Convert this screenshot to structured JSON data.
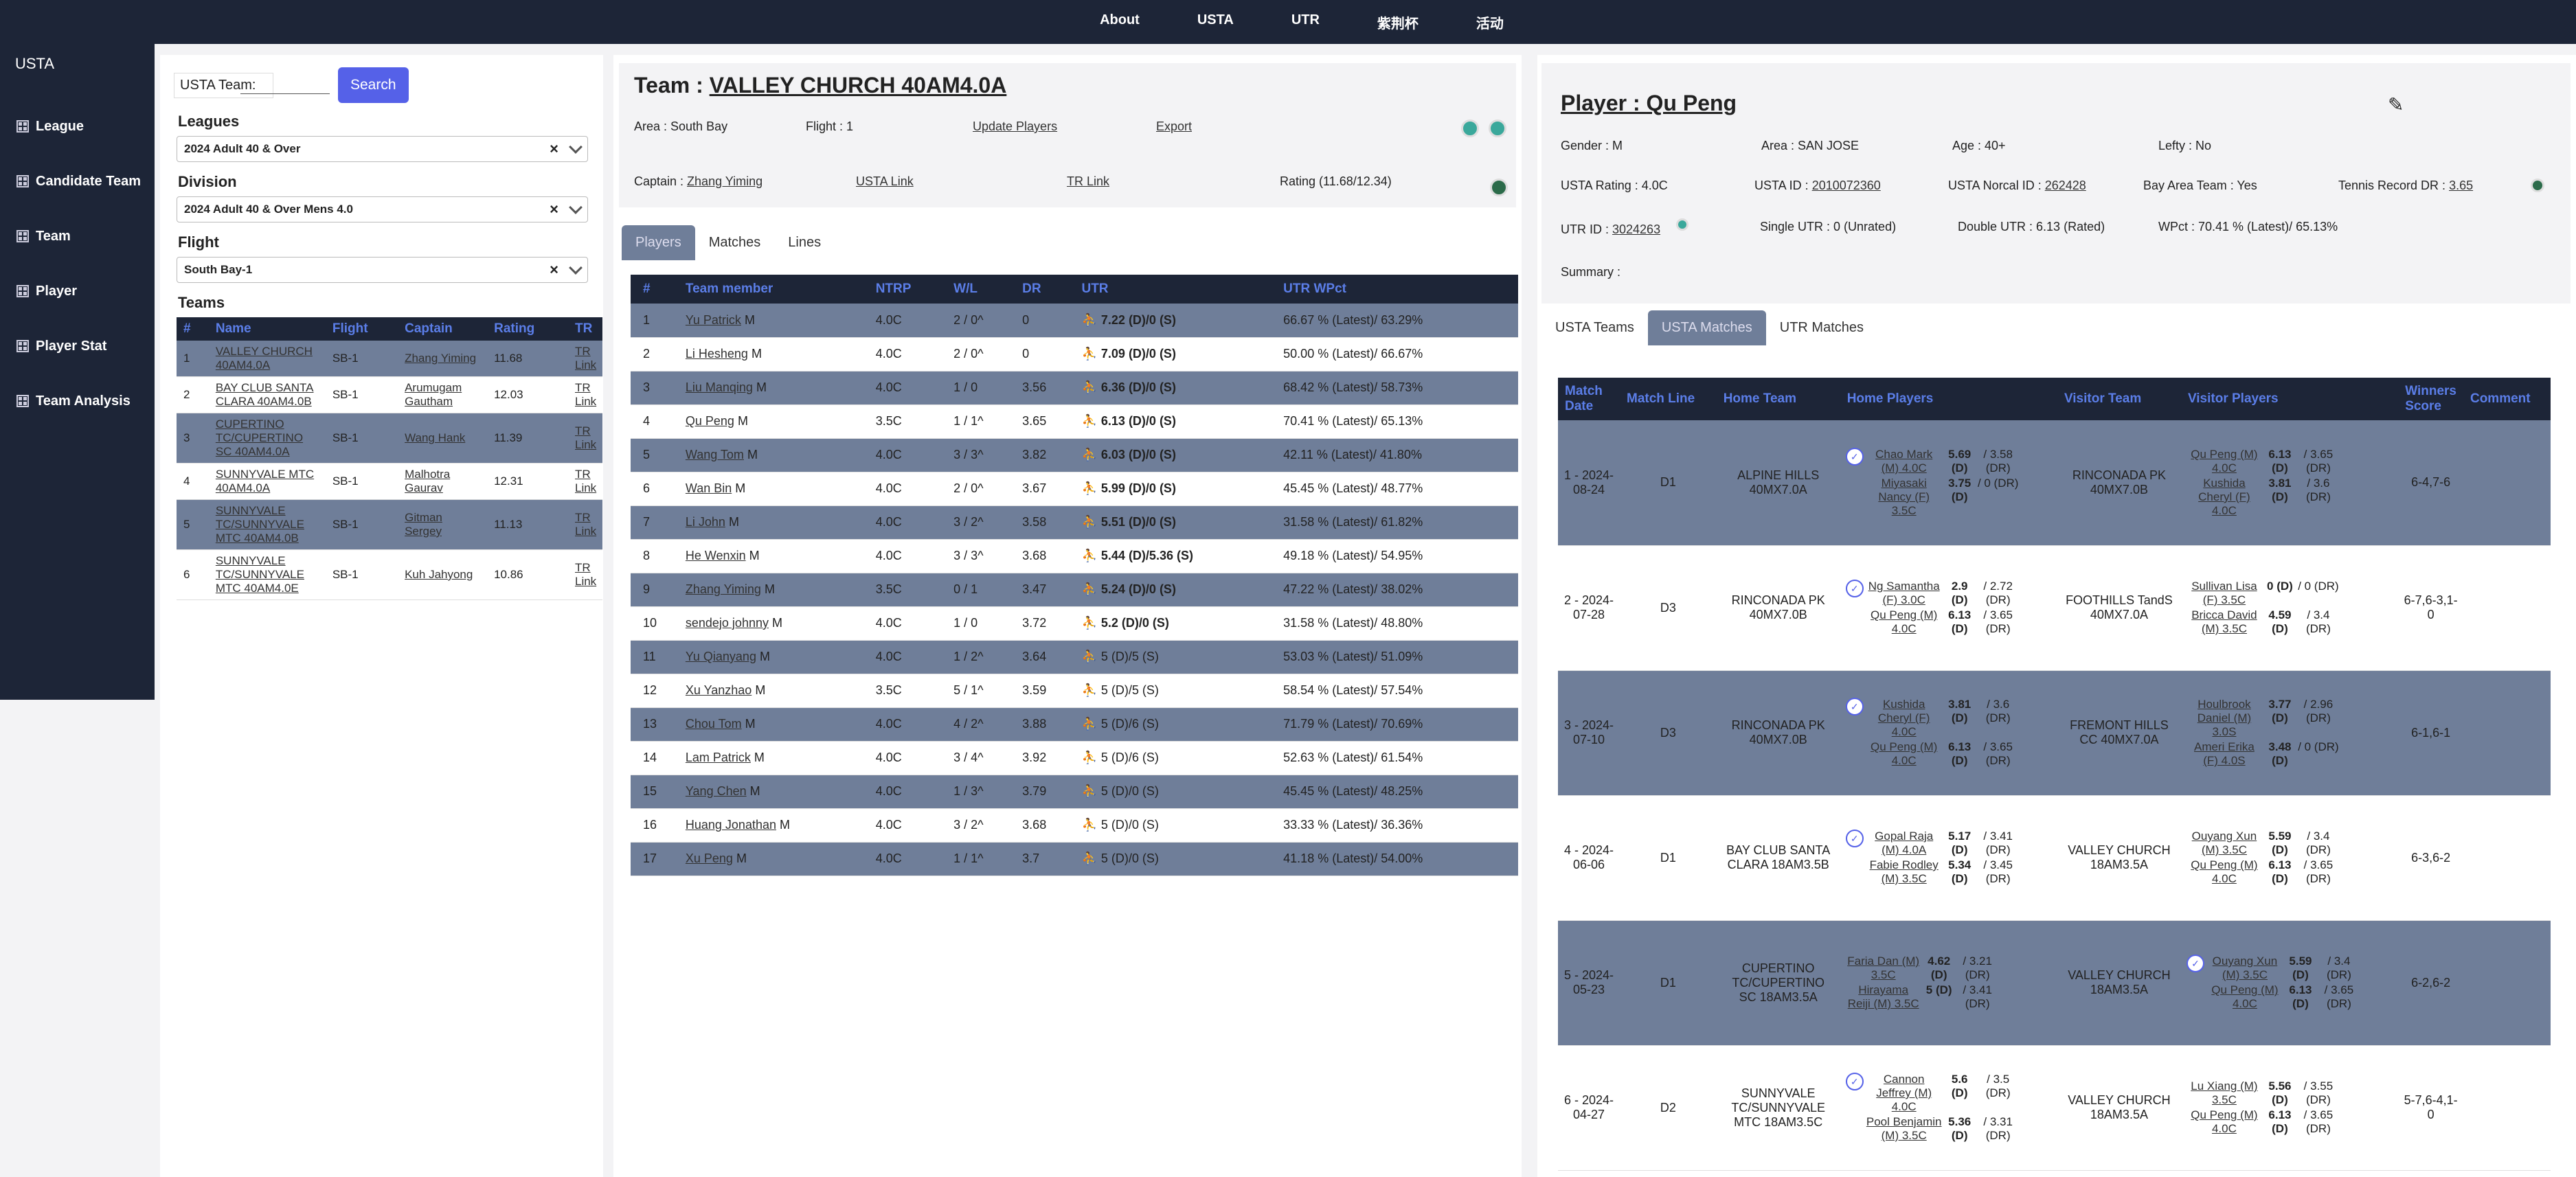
{
  "nav": {
    "items": [
      "About",
      "USTA",
      "UTR",
      "紫荆杯",
      "活动"
    ]
  },
  "sidebar": {
    "brand": "USTA",
    "items": [
      "League",
      "Candidate Team",
      "Team",
      "Player",
      "Player Stat",
      "Team Analysis"
    ]
  },
  "left": {
    "usta_team_label": "USTA Team:",
    "search": "Search",
    "leagues_label": "Leagues",
    "league_value": "2024 Adult 40 & Over",
    "division_label": "Division",
    "division_value": "2024 Adult 40 & Over Mens 4.0",
    "flight_label": "Flight",
    "flight_value": "South Bay-1",
    "teams_label": "Teams",
    "clear": "×",
    "cols": [
      "#",
      "Name",
      "Flight",
      "Captain",
      "Rating",
      "TR"
    ],
    "rows": [
      {
        "n": "1",
        "name": "VALLEY CHURCH 40AM4.0A",
        "flight": "SB-1",
        "captain": "Zhang Yiming",
        "rating": "11.68",
        "tr": "TR Link"
      },
      {
        "n": "2",
        "name": "BAY CLUB SANTA CLARA 40AM4.0B",
        "flight": "SB-1",
        "captain": "Arumugam Gautham",
        "rating": "12.03",
        "tr": "TR Link"
      },
      {
        "n": "3",
        "name": "CUPERTINO TC/CUPERTINO SC 40AM4.0A",
        "flight": "SB-1",
        "captain": "Wang Hank",
        "rating": "11.39",
        "tr": "TR Link"
      },
      {
        "n": "4",
        "name": "SUNNYVALE MTC 40AM4.0A",
        "flight": "SB-1",
        "captain": "Malhotra Gaurav",
        "rating": "12.31",
        "tr": "TR Link"
      },
      {
        "n": "5",
        "name": "SUNNYVALE TC/SUNNYVALE MTC 40AM4.0B",
        "flight": "SB-1",
        "captain": "Gitman Sergey",
        "rating": "11.13",
        "tr": "TR Link"
      },
      {
        "n": "6",
        "name": "SUNNYVALE TC/SUNNYVALE MTC 40AM4.0E",
        "flight": "SB-1",
        "captain": "Kuh Jahyong",
        "rating": "10.86",
        "tr": "TR Link"
      }
    ]
  },
  "team": {
    "title_prefix": "Team : ",
    "title": "VALLEY CHURCH 40AM4.0A",
    "area": "Area : South Bay",
    "flight": "Flight : 1",
    "update": "Update Players",
    "export": "Export",
    "captain_prefix": "Captain : ",
    "captain": "Zhang Yiming",
    "usta_link": "USTA Link",
    "tr_link": "TR Link",
    "rating": "Rating (11.68/12.34)",
    "tabs": [
      "Players",
      "Matches",
      "Lines"
    ],
    "cols": [
      "#",
      "Team member",
      "NTRP",
      "W/L",
      "DR",
      "UTR",
      "UTR WPct"
    ],
    "rows": [
      {
        "n": "1",
        "name": "Yu Patrick",
        "g": "M",
        "ntrp": "4.0C",
        "wl": "2 / 0^",
        "dr": "0",
        "utr": "7.22 (D)/0 (S)",
        "wp": "66.67 % (Latest)/ 63.29%"
      },
      {
        "n": "2",
        "name": "Li Hesheng",
        "g": "M",
        "ntrp": "4.0C",
        "wl": "2 / 0^",
        "dr": "0",
        "utr": "7.09 (D)/0 (S)",
        "wp": "50.00 % (Latest)/ 66.67%"
      },
      {
        "n": "3",
        "name": "Liu Manqing",
        "g": "M",
        "ntrp": "4.0C",
        "wl": "1 / 0",
        "dr": "3.56",
        "utr": "6.36 (D)/0 (S)",
        "wp": "68.42 % (Latest)/ 58.73%"
      },
      {
        "n": "4",
        "name": "Qu Peng",
        "g": "M",
        "ntrp": "3.5C",
        "wl": "1 / 1^",
        "dr": "3.65",
        "utr": "6.13 (D)/0 (S)",
        "wp": "70.41 % (Latest)/ 65.13%"
      },
      {
        "n": "5",
        "name": "Wang Tom",
        "g": "M",
        "ntrp": "4.0C",
        "wl": "3 / 3^",
        "dr": "3.82",
        "utr": "6.03 (D)/0 (S)",
        "wp": "42.11 % (Latest)/ 41.80%"
      },
      {
        "n": "6",
        "name": "Wan Bin",
        "g": "M",
        "ntrp": "4.0C",
        "wl": "2 / 0^",
        "dr": "3.67",
        "utr": "5.99 (D)/0 (S)",
        "wp": "45.45 % (Latest)/ 48.77%"
      },
      {
        "n": "7",
        "name": "Li John",
        "g": "M",
        "ntrp": "4.0C",
        "wl": "3 / 2^",
        "dr": "3.58",
        "utr": "5.51 (D)/0 (S)",
        "wp": "31.58 % (Latest)/ 61.82%"
      },
      {
        "n": "8",
        "name": "He Wenxin",
        "g": "M",
        "ntrp": "4.0C",
        "wl": "3 / 3^",
        "dr": "3.68",
        "utr": "5.44 (D)/5.36 (S)",
        "wp": "49.18 % (Latest)/ 54.95%"
      },
      {
        "n": "9",
        "name": "Zhang Yiming",
        "g": "M",
        "ntrp": "3.5C",
        "wl": "0 / 1",
        "dr": "3.47",
        "utr": "5.24 (D)/0 (S)",
        "wp": "47.22 % (Latest)/ 38.02%"
      },
      {
        "n": "10",
        "name": "sendejo johnny",
        "g": "M",
        "ntrp": "4.0C",
        "wl": "1 / 0",
        "dr": "3.72",
        "utr": "5.2 (D)/0 (S)",
        "wp": "31.58 % (Latest)/ 48.80%"
      },
      {
        "n": "11",
        "name": "Yu Qianyang",
        "g": "M",
        "ntrp": "4.0C",
        "wl": "1 / 2^",
        "dr": "3.64",
        "utr": "5 (D)/5 (S)",
        "wp": "53.03 % (Latest)/ 51.09%"
      },
      {
        "n": "12",
        "name": "Xu Yanzhao",
        "g": "M",
        "ntrp": "3.5C",
        "wl": "5 / 1^",
        "dr": "3.59",
        "utr": "5 (D)/5 (S)",
        "wp": "58.54 % (Latest)/ 57.54%"
      },
      {
        "n": "13",
        "name": "Chou Tom",
        "g": "M",
        "ntrp": "4.0C",
        "wl": "4 / 2^",
        "dr": "3.88",
        "utr": "5 (D)/6 (S)",
        "wp": "71.79 % (Latest)/ 70.69%"
      },
      {
        "n": "14",
        "name": "Lam Patrick",
        "g": "M",
        "ntrp": "4.0C",
        "wl": "3 / 4^",
        "dr": "3.92",
        "utr": "5 (D)/6 (S)",
        "wp": "52.63 % (Latest)/ 61.54%"
      },
      {
        "n": "15",
        "name": "Yang Chen",
        "g": "M",
        "ntrp": "4.0C",
        "wl": "1 / 3^",
        "dr": "3.79",
        "utr": "5 (D)/0 (S)",
        "wp": "45.45 % (Latest)/ 48.25%"
      },
      {
        "n": "16",
        "name": "Huang Jonathan",
        "g": "M",
        "ntrp": "4.0C",
        "wl": "3 / 2^",
        "dr": "3.68",
        "utr": "5 (D)/0 (S)",
        "wp": "33.33 % (Latest)/ 36.36%"
      },
      {
        "n": "17",
        "name": "Xu Peng",
        "g": "M",
        "ntrp": "4.0C",
        "wl": "1 / 1^",
        "dr": "3.7",
        "utr": "5 (D)/0 (S)",
        "wp": "41.18 % (Latest)/ 54.00%"
      }
    ]
  },
  "player": {
    "title_prefix": "Player : ",
    "name": "Qu Peng",
    "gender": "Gender : M",
    "area": "Area : SAN JOSE",
    "age": "Age : 40+",
    "lefty": "Lefty : No",
    "usta_rating": "USTA Rating : 4.0C",
    "usta_id_label": "USTA ID : ",
    "usta_id": "2010072360",
    "norcal_label": "USTA Norcal ID : ",
    "norcal_id": "262428",
    "bay_area": "Bay Area Team : Yes",
    "tr_label": "Tennis Record DR : ",
    "tr_dr": "3.65",
    "utr_id_label": "UTR ID : ",
    "utr_id": "3024263",
    "single_utr": "Single UTR : 0 (Unrated)",
    "double_utr": "Double UTR : 6.13 (Rated)",
    "wpct": "WPct : 70.41 % (Latest)/ 65.13%",
    "summary": "Summary :",
    "tabs": [
      "USTA Teams",
      "USTA Matches",
      "UTR Matches"
    ],
    "cols": [
      "Match Date",
      "Match Line",
      "Home Team",
      "Home Players",
      "Visitor Team",
      "Visitor Players",
      "Winners Score",
      "Comment"
    ],
    "matches": [
      {
        "date": "1 - 2024-08-24",
        "line": "D1",
        "home": "ALPINE HILLS 40MX7.0A",
        "visitor": "RINCONADA PK 40MX7.0B",
        "score": "6-4,7-6",
        "hp": [
          {
            "n": "Chao Mark (M) 4.0C",
            "u": "5.69 (D)",
            "d": "/ 3.58 (DR)"
          },
          {
            "n": "Miyasaki Nancy (F) 3.5C",
            "u": "3.75 (D)",
            "d": "/ 0 (DR)"
          }
        ],
        "vp": [
          {
            "n": "Qu Peng (M) 4.0C",
            "u": "6.13 (D)",
            "d": "/ 3.65 (DR)"
          },
          {
            "n": "Kushida Cheryl (F) 4.0C",
            "u": "3.81 (D)",
            "d": "/ 3.6 (DR)"
          }
        ],
        "hc": true,
        "vc": false
      },
      {
        "date": "2 - 2024-07-28",
        "line": "D3",
        "home": "RINCONADA PK 40MX7.0B",
        "visitor": "FOOTHILLS TandS 40MX7.0A",
        "score": "6-7,6-3,1-0",
        "hp": [
          {
            "n": "Ng Samantha (F) 3.0C",
            "u": "2.9 (D)",
            "d": "/ 2.72 (DR)"
          },
          {
            "n": "Qu Peng (M) 4.0C",
            "u": "6.13 (D)",
            "d": "/ 3.65 (DR)"
          }
        ],
        "vp": [
          {
            "n": "Sullivan Lisa (F) 3.5C",
            "u": "0 (D)",
            "d": "/ 0 (DR)"
          },
          {
            "n": "Bricca David (M) 3.5C",
            "u": "4.59 (D)",
            "d": "/ 3.4 (DR)"
          }
        ],
        "hc": true,
        "vc": false
      },
      {
        "date": "3 - 2024-07-10",
        "line": "D3",
        "home": "RINCONADA PK 40MX7.0B",
        "visitor": "FREMONT HILLS CC 40MX7.0A",
        "score": "6-1,6-1",
        "hp": [
          {
            "n": "Kushida Cheryl (F) 4.0C",
            "u": "3.81 (D)",
            "d": "/ 3.6 (DR)"
          },
          {
            "n": "Qu Peng (M) 4.0C",
            "u": "6.13 (D)",
            "d": "/ 3.65 (DR)"
          }
        ],
        "vp": [
          {
            "n": "Houlbrook Daniel (M) 3.0S",
            "u": "3.77 (D)",
            "d": "/ 2.96 (DR)"
          },
          {
            "n": "Ameri Erika (F) 4.0S",
            "u": "3.48 (D)",
            "d": "/ 0 (DR)"
          }
        ],
        "hc": true,
        "vc": false
      },
      {
        "date": "4 - 2024-06-06",
        "line": "D1",
        "home": "BAY CLUB SANTA CLARA 18AM3.5B",
        "visitor": "VALLEY CHURCH 18AM3.5A",
        "score": "6-3,6-2",
        "hp": [
          {
            "n": "Gopal Raja (M) 4.0A",
            "u": "5.17 (D)",
            "d": "/ 3.41 (DR)"
          },
          {
            "n": "Fabie Rodley (M) 3.5C",
            "u": "5.34 (D)",
            "d": "/ 3.45 (DR)"
          }
        ],
        "vp": [
          {
            "n": "Ouyang Xun (M) 3.5C",
            "u": "5.59 (D)",
            "d": "/ 3.4 (DR)"
          },
          {
            "n": "Qu Peng (M) 4.0C",
            "u": "6.13 (D)",
            "d": "/ 3.65 (DR)"
          }
        ],
        "hc": true,
        "vc": false
      },
      {
        "date": "5 - 2024-05-23",
        "line": "D1",
        "home": "CUPERTINO TC/CUPERTINO SC 18AM3.5A",
        "visitor": "VALLEY CHURCH 18AM3.5A",
        "score": "6-2,6-2",
        "hp": [
          {
            "n": "Faria Dan (M) 3.5C",
            "u": "4.62 (D)",
            "d": "/ 3.21 (DR)"
          },
          {
            "n": "Hirayama Reiji (M) 3.5C",
            "u": "5 (D)",
            "d": "/ 3.41 (DR)"
          }
        ],
        "vp": [
          {
            "n": "Ouyang Xun (M) 3.5C",
            "u": "5.59 (D)",
            "d": "/ 3.4 (DR)"
          },
          {
            "n": "Qu Peng (M) 4.0C",
            "u": "6.13 (D)",
            "d": "/ 3.65 (DR)"
          }
        ],
        "hc": false,
        "vc": true
      },
      {
        "date": "6 - 2024-04-27",
        "line": "D2",
        "home": "SUNNYVALE TC/SUNNYVALE MTC 18AM3.5C",
        "visitor": "VALLEY CHURCH 18AM3.5A",
        "score": "5-7,6-4,1-0",
        "hp": [
          {
            "n": "Cannon Jeffrey (M) 4.0C",
            "u": "5.6 (D)",
            "d": "/ 3.5 (DR)"
          },
          {
            "n": "Pool Benjamin (M) 3.5C",
            "u": "5.36 (D)",
            "d": "/ 3.31 (DR)"
          }
        ],
        "vp": [
          {
            "n": "Lu Xiang (M) 3.5C",
            "u": "5.56 (D)",
            "d": "/ 3.55 (DR)"
          },
          {
            "n": "Qu Peng (M) 4.0C",
            "u": "6.13 (D)",
            "d": "/ 3.65 (DR)"
          }
        ],
        "hc": true,
        "vc": false
      }
    ]
  }
}
